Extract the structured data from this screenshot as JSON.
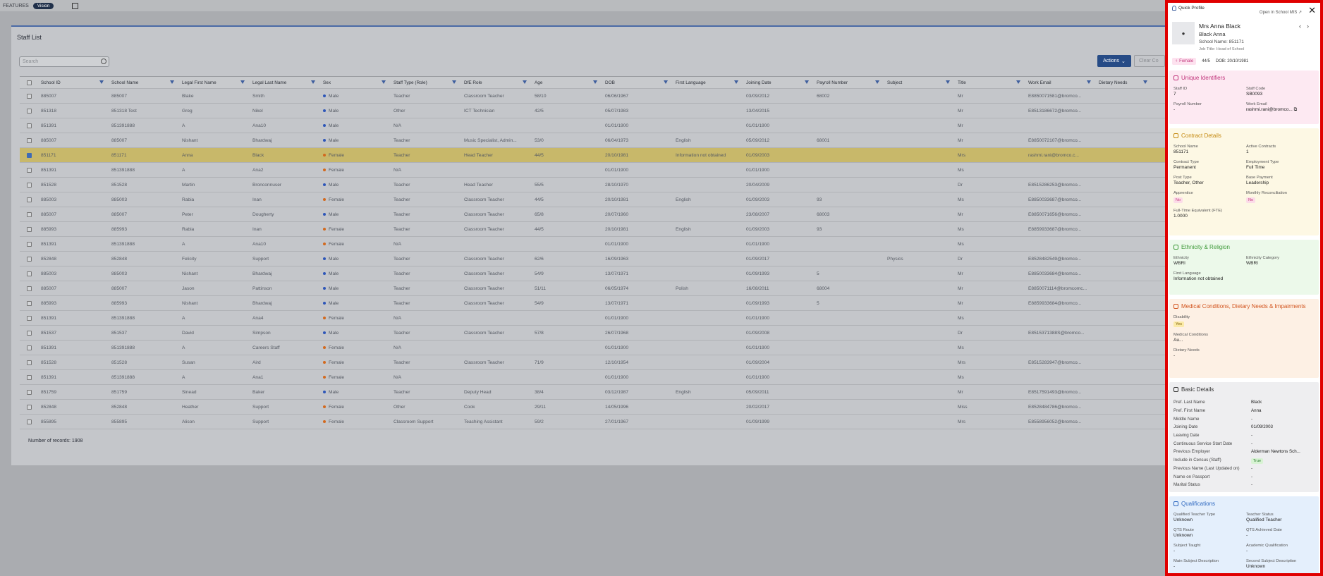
{
  "topbar": {
    "features": "FEATURES",
    "vision": "Vision"
  },
  "staff": {
    "title": "Staff List",
    "search_placeholder": "Search",
    "actions": "Actions",
    "clear": "Clear Co",
    "footer": "Number of records: 1908"
  },
  "columns": [
    "School ID",
    "School Name",
    "Legal First Name",
    "Legal Last Name",
    "Sex",
    "Staff Type (Role)",
    "DfE Role",
    "Age",
    "DOB",
    "First Language",
    "Joining Date",
    "Payroll Number",
    "Subject",
    "Title",
    "Work Email",
    "Dietary Needs"
  ],
  "rows": [
    [
      "885007",
      "885007",
      "Blake",
      "Smith",
      "Male",
      "Teacher",
      "Classroom Teacher",
      "58/10",
      "06/06/1967",
      "",
      "03/09/2012",
      "68002",
      "",
      "Mr",
      "E8850071581@bromco..."
    ],
    [
      "851318",
      "851318 Test",
      "Greg",
      "Nikel",
      "Male",
      "Other",
      "ICT Technician",
      "42/5",
      "05/07/1983",
      "",
      "13/04/2015",
      "",
      "",
      "Mr",
      "E8513186672@bromco..."
    ],
    [
      "851391",
      "851391888",
      "A",
      "Ana10",
      "Male",
      "N/A",
      "",
      "",
      "01/01/1900",
      "",
      "01/01/1900",
      "",
      "",
      "Mr",
      ""
    ],
    [
      "885007",
      "885007",
      "Nishant",
      "Bhardwaj",
      "Male",
      "Teacher",
      "Music Specialist, Admin...",
      "53/0",
      "06/04/1973",
      "English",
      "05/09/2012",
      "68001",
      "",
      "Mr",
      "E8850072107@bromco..."
    ],
    [
      "851171",
      "851171",
      "Anna",
      "Black",
      "Female",
      "Teacher",
      "Head Teacher",
      "44/5",
      "20/10/1981",
      "Information not obtained",
      "01/09/2003",
      "",
      "",
      "Mrs",
      "rashmi.rani@bromco.c..."
    ],
    [
      "851391",
      "851391888",
      "A",
      "Ana2",
      "Female",
      "N/A",
      "",
      "",
      "01/01/1900",
      "",
      "01/01/1900",
      "",
      "",
      "Ms",
      ""
    ],
    [
      "851528",
      "851528",
      "Martin",
      "Bronconnuser",
      "Male",
      "Teacher",
      "Head Teacher",
      "55/5",
      "28/10/1970",
      "",
      "20/04/2009",
      "",
      "",
      "Dr",
      "E8515286253@bromco..."
    ],
    [
      "885003",
      "885003",
      "Rabia",
      "Inan",
      "Female",
      "Teacher",
      "Classroom Teacher",
      "44/5",
      "20/10/1981",
      "English",
      "01/09/2003",
      "93",
      "",
      "Ms",
      "E8850033687@bromco..."
    ],
    [
      "885007",
      "885007",
      "Peter",
      "Dougherty",
      "Male",
      "Teacher",
      "Classroom Teacher",
      "65/8",
      "20/07/1960",
      "",
      "23/08/2007",
      "68003",
      "",
      "Mr",
      "E8850071656@bromco..."
    ],
    [
      "885993",
      "885993",
      "Rabia",
      "Inan",
      "Female",
      "Teacher",
      "Classroom Teacher",
      "44/5",
      "20/10/1981",
      "English",
      "01/09/2003",
      "93",
      "",
      "Ms",
      "E8859933687@bromco..."
    ],
    [
      "851391",
      "851391888",
      "A",
      "Ana10",
      "Female",
      "N/A",
      "",
      "",
      "01/01/1900",
      "",
      "01/01/1900",
      "",
      "",
      "Ms",
      ""
    ],
    [
      "852848",
      "852848",
      "Felicity",
      "Support",
      "Male",
      "Teacher",
      "Classroom Teacher",
      "62/6",
      "16/09/1963",
      "",
      "01/09/2017",
      "",
      "Physics",
      "Dr",
      "E8528482549@bromco..."
    ],
    [
      "885003",
      "885003",
      "Nishant",
      "Bhardwaj",
      "Male",
      "Teacher",
      "Classroom Teacher",
      "54/9",
      "13/07/1971",
      "",
      "01/09/1993",
      "5",
      "",
      "Mr",
      "E8850033684@bromco..."
    ],
    [
      "885007",
      "885007",
      "Jason",
      "Pattinson",
      "Male",
      "Teacher",
      "Classroom Teacher",
      "51/11",
      "06/05/1974",
      "Polish",
      "16/08/2011",
      "68004",
      "",
      "Mr",
      "E8850071114@bromcomc..."
    ],
    [
      "885993",
      "885993",
      "Nishant",
      "Bhardwaj",
      "Male",
      "Teacher",
      "Classroom Teacher",
      "54/9",
      "13/07/1971",
      "",
      "01/09/1993",
      "5",
      "",
      "Mr",
      "E8859933684@bromco..."
    ],
    [
      "851391",
      "851391888",
      "A",
      "Ana4",
      "Female",
      "N/A",
      "",
      "",
      "01/01/1900",
      "",
      "01/01/1900",
      "",
      "",
      "Ms",
      ""
    ],
    [
      "851537",
      "851537",
      "David",
      "Simpson",
      "Male",
      "Teacher",
      "Classroom Teacher",
      "57/8",
      "26/07/1968",
      "",
      "01/09/2008",
      "",
      "",
      "Dr",
      "E8515371388S@bromco..."
    ],
    [
      "851391",
      "851391888",
      "A",
      "Careers Staff",
      "Female",
      "N/A",
      "",
      "",
      "01/01/1900",
      "",
      "01/01/1900",
      "",
      "",
      "Ms",
      ""
    ],
    [
      "851528",
      "851528",
      "Susan",
      "Aird",
      "Female",
      "Teacher",
      "Classroom Teacher",
      "71/9",
      "12/10/1954",
      "",
      "01/09/2004",
      "",
      "",
      "Mrs",
      "E8515283947@bromco..."
    ],
    [
      "851391",
      "851391888",
      "A",
      "Ana1",
      "Female",
      "N/A",
      "",
      "",
      "01/01/1900",
      "",
      "01/01/1900",
      "",
      "",
      "Ms",
      ""
    ],
    [
      "851759",
      "851759",
      "Sinead",
      "Baker",
      "Male",
      "Teacher",
      "Deputy Head",
      "38/4",
      "03/12/1987",
      "English",
      "05/09/2011",
      "",
      "",
      "Mr",
      "E8517591493@bromco..."
    ],
    [
      "852848",
      "852848",
      "Heather",
      "Support",
      "Female",
      "Other",
      "Cook",
      "29/11",
      "14/05/1996",
      "",
      "20/02/2017",
      "",
      "",
      "Miss",
      "E8528484786@bromco..."
    ],
    [
      "855895",
      "855895",
      "Alison",
      "Support",
      "Female",
      "Classroom Support",
      "Teaching Assistant",
      "59/2",
      "27/01/1967",
      "",
      "01/09/1999",
      "",
      "",
      "Mrs",
      "E8558956052@bromco..."
    ]
  ],
  "colors": {
    "male": "#2e56b8",
    "female": "#d2691e",
    "accent": "#264b86"
  },
  "profile": {
    "quick_profile": "Quick Profile",
    "open_mis": "Open in School MIS",
    "close": "✕",
    "name": "Mrs Anna Black",
    "legal_name": "Black Anna",
    "school": "School Name: 851171",
    "job_title": "Job Title: Head of School",
    "sex": "Female",
    "age": "44/5",
    "dob": "DOB: 20/10/1981",
    "unique": {
      "title": "Unique Identifiers",
      "staff_id_l": "Staff ID",
      "staff_id": "7",
      "staff_code_l": "Staff Code",
      "staff_code": "SB0093",
      "payroll_l": "Payroll Number",
      "payroll": "-",
      "email_l": "Work Email",
      "email": "rashmi.rani@bromco..."
    },
    "contract": {
      "title": "Contract Details",
      "fields": [
        [
          "School Name",
          "851171"
        ],
        [
          "Active Contracts",
          "1"
        ],
        [
          "Contract Type",
          "Permanent"
        ],
        [
          "Employment Type",
          "Full Time"
        ],
        [
          "Post Type",
          "Teacher, Other"
        ],
        [
          "Base Payment",
          "Leadership"
        ],
        [
          "Apprentice",
          "No"
        ],
        [
          "Monthly Reconciliation",
          "No"
        ],
        [
          "Full-Time Equivalent (FTE)",
          "1.0000"
        ]
      ]
    },
    "ethnicity": {
      "title": "Ethnicity & Religion",
      "fields": [
        [
          "Ethnicity",
          "WBRI"
        ],
        [
          "Ethnicity Category",
          "WBRI"
        ],
        [
          "First Language",
          "Information not obtained"
        ]
      ]
    },
    "medical": {
      "title": "Medical Conditions, Dietary Needs & Impairments",
      "fields": [
        [
          "Disability",
          "Yes"
        ],
        [
          "Medical Conditions",
          "Au..."
        ],
        [
          "Dietary Needs",
          "-"
        ]
      ]
    },
    "basic": {
      "title": "Basic Details",
      "fields": [
        [
          "Pref. Last Name",
          "Black"
        ],
        [
          "Pref. First Name",
          "Anna"
        ],
        [
          "Middle Name",
          "-"
        ],
        [
          "Joining Date",
          "01/09/2003"
        ],
        [
          "Leaving Date",
          "-"
        ],
        [
          "Continuous Service Start Date",
          "-"
        ],
        [
          "Previous Employer",
          "Alderman Newtons Sch..."
        ],
        [
          "Include in Census (Staff)",
          "True"
        ],
        [
          "Previous Name (Last Updated on)",
          "-"
        ],
        [
          "Name on Passport",
          "-"
        ],
        [
          "Marital Status",
          "-"
        ]
      ]
    },
    "qual": {
      "title": "Qualifications",
      "fields": [
        [
          "Qualified Teacher Type",
          "Unknown"
        ],
        [
          "Teacher Status",
          "Qualified Teacher"
        ],
        [
          "QTS Route",
          "Unknown"
        ],
        [
          "QTS Achieved Date",
          "-"
        ],
        [
          "Subject Taught",
          "-"
        ],
        [
          "Academic Qualification",
          "-"
        ],
        [
          "Main Subject Description",
          "-"
        ],
        [
          "Second Subject Description",
          "Unknown"
        ]
      ]
    }
  }
}
